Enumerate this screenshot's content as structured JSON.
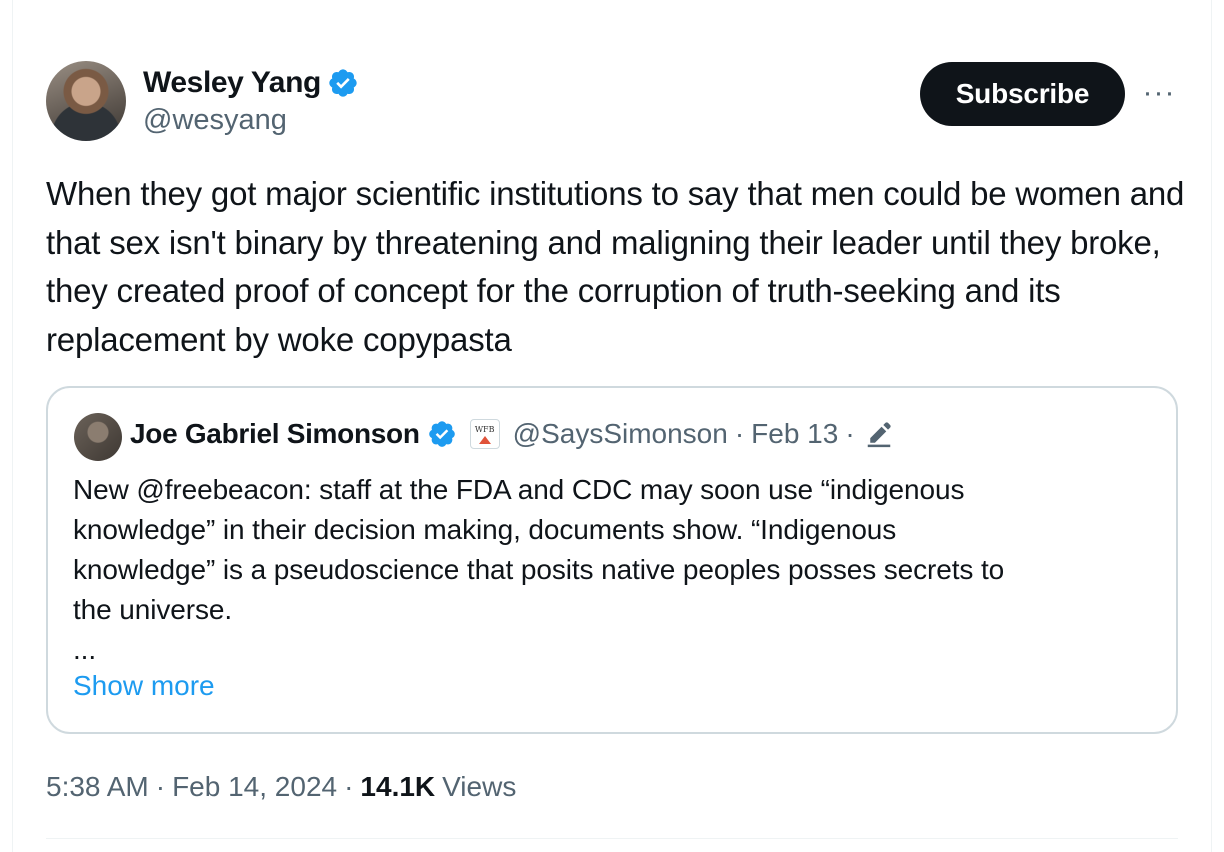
{
  "author": {
    "display_name": "Wesley Yang",
    "handle": "@wesyang",
    "verified": true
  },
  "actions": {
    "subscribe_label": "Subscribe",
    "more_label": "···"
  },
  "tweet": {
    "text": "When they got major scientific institutions to say that men could be women and that sex isn't binary by threatening and maligning their leader until they broke, they created proof of concept for the corruption of truth-seeking and its replacement by woke copypasta"
  },
  "quote": {
    "display_name": "Joe Gabriel Simonson",
    "verified": true,
    "affiliate_badge_text": "WFB",
    "handle": "@SaysSimonson",
    "separator": "·",
    "date": "Feb 13",
    "text_lines": [
      "New @freebeacon: staff at the FDA and CDC may soon use “indigenous",
      "knowledge” in their decision making, documents show. “Indigenous",
      "knowledge” is a pseudoscience that posits native peoples posses secrets to",
      "the universe."
    ],
    "ellipsis": "...",
    "show_more_label": "Show more"
  },
  "meta": {
    "time": "5:38 AM",
    "separator": "·",
    "date": "Feb 14, 2024",
    "views_count": "14.1K",
    "views_label": "Views"
  },
  "colors": {
    "verified_blue": "#1d9bf0",
    "text_primary": "#0f1419",
    "text_secondary": "#536471",
    "border": "#cfd9de"
  }
}
